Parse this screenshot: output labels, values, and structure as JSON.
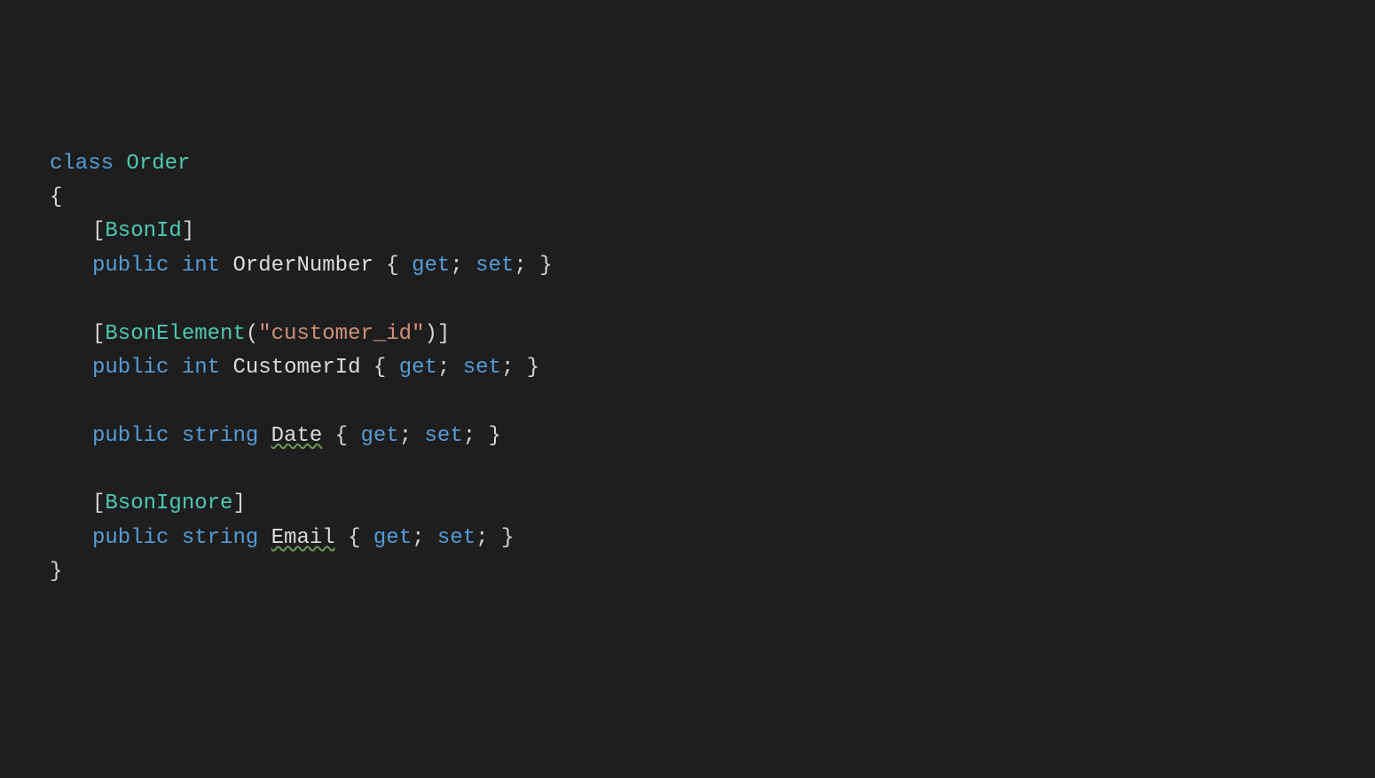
{
  "code": {
    "classKeyword": "class",
    "className": "Order",
    "openBrace": "{",
    "closeBrace": "}",
    "bracketOpen": "[",
    "bracketClose": "]",
    "parenOpen": "(",
    "parenClose": ")",
    "semicolon": ";",
    "propBlockOpen": "{",
    "propBlockClose": "}",
    "get": "get",
    "set": "set",
    "public": "public",
    "intType": "int",
    "stringType": "string",
    "attr1": "BsonId",
    "attr2": "BsonElement",
    "attr2Arg": "\"customer_id\"",
    "attr3": "BsonIgnore",
    "prop1": "OrderNumber",
    "prop2": "CustomerId",
    "prop3": "Date",
    "prop4": "Email"
  }
}
